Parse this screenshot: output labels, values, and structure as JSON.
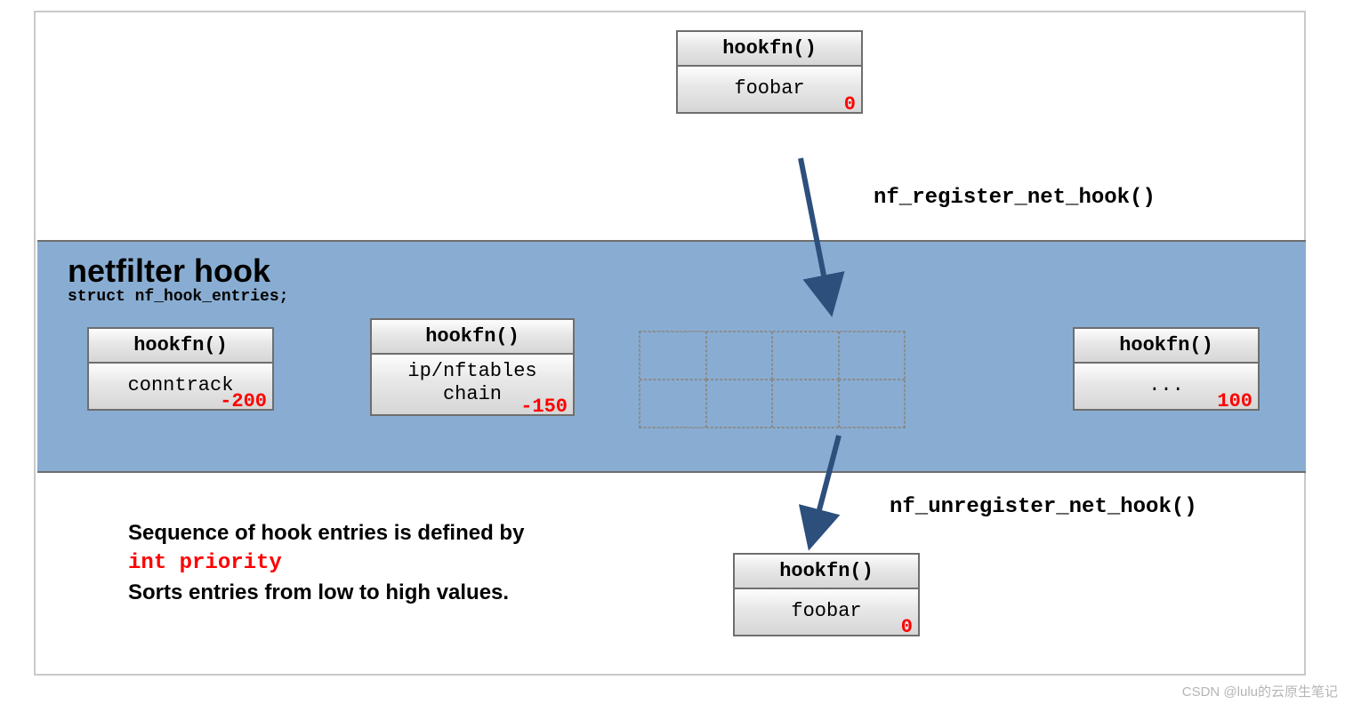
{
  "top_box": {
    "header": "hookfn()",
    "body": "foobar",
    "priority": "0"
  },
  "register_label": "nf_register_net_hook()",
  "unregister_label": "nf_unregister_net_hook()",
  "bluebar": {
    "title": "netfilter hook",
    "subtitle": "struct nf_hook_entries;"
  },
  "entries": [
    {
      "header": "hookfn()",
      "body": "conntrack",
      "priority": "-200"
    },
    {
      "header": "hookfn()",
      "body": "ip/nftables chain",
      "priority": "-150"
    },
    {
      "header": "hookfn()",
      "body": "...",
      "priority": "100"
    }
  ],
  "sequence_text": {
    "line1": "Sequence of hook entries is defined by",
    "line2": "int priority",
    "line3": "Sorts entries from low to high values."
  },
  "bottom_box": {
    "header": "hookfn()",
    "body": "foobar",
    "priority": "0"
  },
  "watermark": "CSDN @lulu的云原生笔记"
}
